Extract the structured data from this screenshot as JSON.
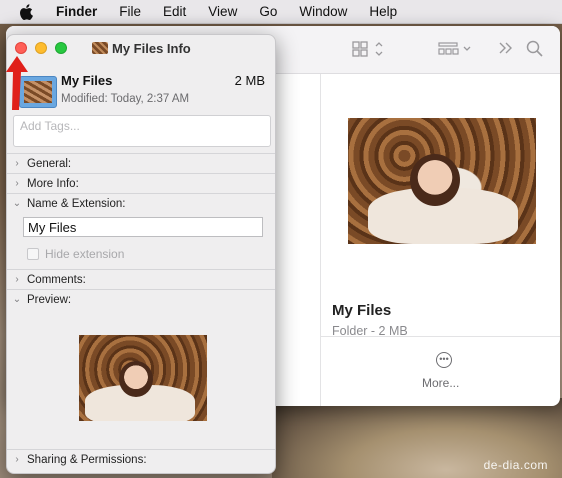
{
  "menubar": {
    "items": [
      "Finder",
      "File",
      "Edit",
      "View",
      "Go",
      "Window",
      "Help"
    ]
  },
  "finder": {
    "preview_name": "My Files",
    "preview_sub": "Folder - 2 MB",
    "more_label": "More..."
  },
  "info": {
    "title": "My Files Info",
    "file_name": "My Files",
    "file_size": "2 MB",
    "modified": "Modified: Today, 2:37 AM",
    "tags_placeholder": "Add Tags...",
    "sections": {
      "general": "General:",
      "more_info": "More Info:",
      "name_ext": "Name & Extension:",
      "comments": "Comments:",
      "preview": "Preview:",
      "sharing": "Sharing & Permissions:"
    },
    "name_value": "My Files",
    "hide_extension": "Hide extension"
  },
  "watermark": "de-dia.com",
  "colors": {
    "close": "#ff5f57",
    "minimize": "#febc2e",
    "zoom": "#28c840",
    "annotation_arrow": "#e0201a"
  }
}
